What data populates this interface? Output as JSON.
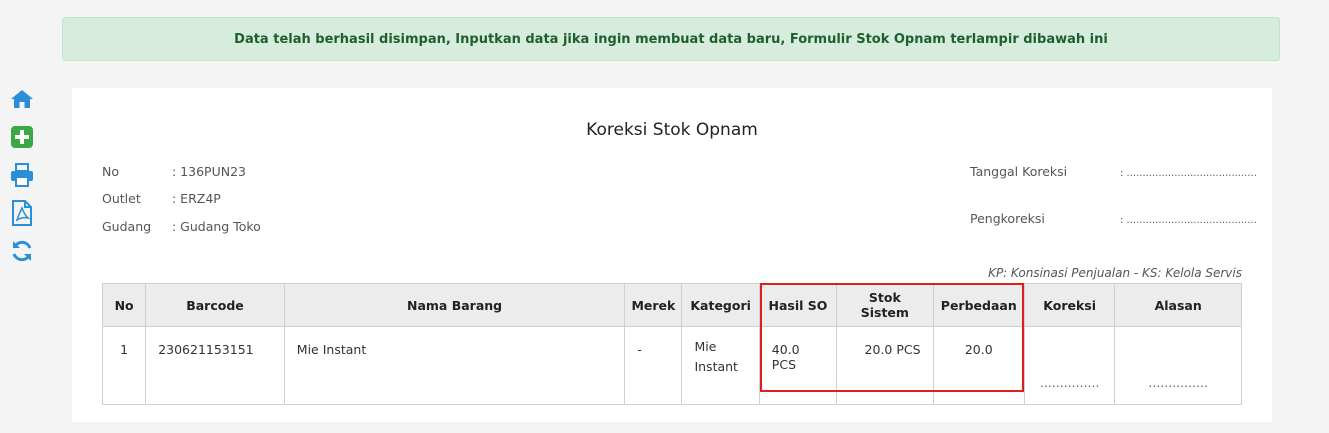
{
  "alert": {
    "message": "Data telah berhasil disimpan, Inputkan data jika ingin membuat data baru, Formulir Stok Opnam terlampir dibawah ini"
  },
  "sidebar": {
    "icons": [
      "home-icon",
      "add-icon",
      "print-icon",
      "pdf-icon",
      "refresh-icon"
    ]
  },
  "form": {
    "title": "Koreksi Stok Opnam",
    "no_label": "No",
    "no_value": ": 136PUN23",
    "outlet_label": "Outlet",
    "outlet_value": ": ERZ4P",
    "gudang_label": "Gudang",
    "gudang_value": ": Gudang Toko",
    "tanggal_label": "Tanggal Koreksi",
    "tanggal_value": ": .........................................",
    "pengkoreksi_label": "Pengkoreksi",
    "pengkoreksi_value": ": .........................................",
    "note": "KP: Konsinasi Penjualan - KS: Kelola Servis"
  },
  "table": {
    "headers": [
      "No",
      "Barcode",
      "Nama Barang",
      "Merek",
      "Kategori",
      "Hasil SO",
      "Stok Sistem",
      "Perbedaan",
      "Koreksi",
      "Alasan"
    ],
    "rows": [
      {
        "no": "1",
        "barcode": "230621153151",
        "nama": "Mie Instant",
        "merek": "-",
        "kategori": "Mie Instant",
        "hasil_so": "40.0 PCS",
        "stok_sistem": "20.0 PCS",
        "perbedaan": "20.0",
        "koreksi": "...............",
        "alasan": "..............."
      }
    ]
  },
  "colors": {
    "accent": "#2a8fd6",
    "highlight": "#e01e1e",
    "alert_bg": "#d6eddd"
  }
}
